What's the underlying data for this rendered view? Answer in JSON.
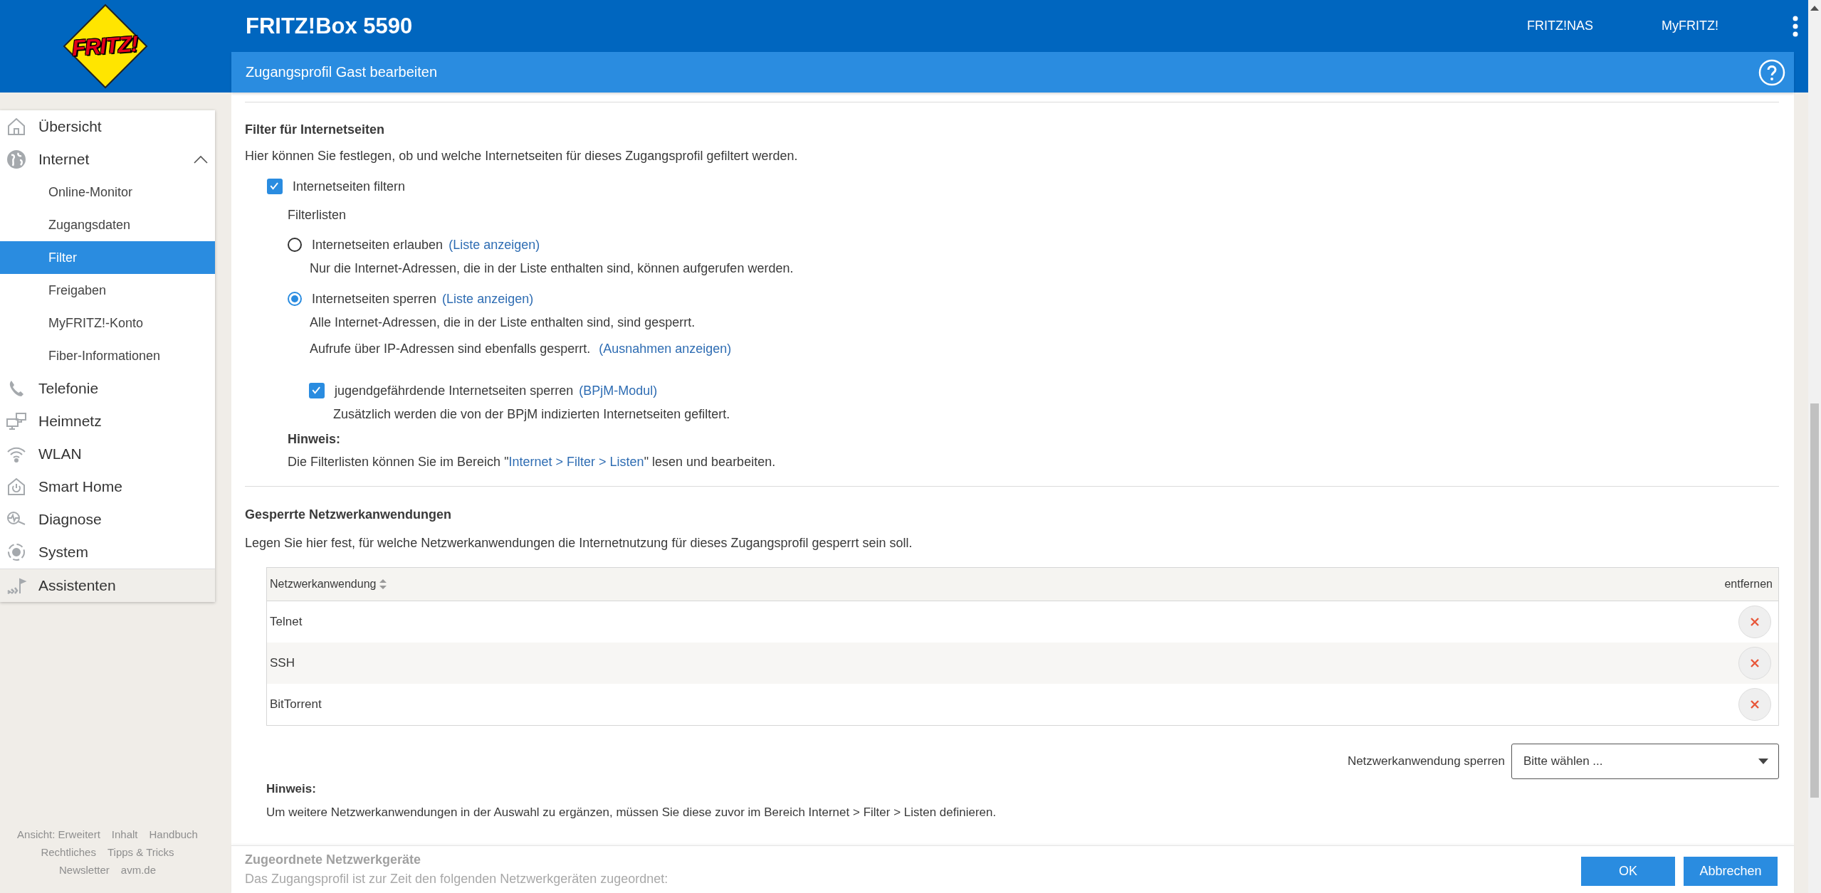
{
  "logo": {
    "text": "FRITZ!"
  },
  "header": {
    "title": "FRITZ!Box 5590",
    "links": [
      "FRITZ!NAS",
      "MyFRITZ!"
    ]
  },
  "sidebar": {
    "items": [
      {
        "label": "Übersicht",
        "kind": "home",
        "selected": false,
        "expanded": false
      },
      {
        "label": "Internet",
        "kind": "globe",
        "selected": false,
        "expanded": true,
        "children": [
          {
            "label": "Online-Monitor",
            "selected": false
          },
          {
            "label": "Zugangsdaten",
            "selected": false
          },
          {
            "label": "Filter",
            "selected": true
          },
          {
            "label": "Freigaben",
            "selected": false
          },
          {
            "label": "MyFRITZ!-Konto",
            "selected": false
          },
          {
            "label": "Fiber-Informationen",
            "selected": false
          }
        ]
      },
      {
        "label": "Telefonie",
        "kind": "phone",
        "selected": false,
        "expanded": false
      },
      {
        "label": "Heimnetz",
        "kind": "network",
        "selected": false,
        "expanded": false
      },
      {
        "label": "WLAN",
        "kind": "wifi",
        "selected": false,
        "expanded": false
      },
      {
        "label": "Smart Home",
        "kind": "smarthome",
        "selected": false,
        "expanded": false
      },
      {
        "label": "Diagnose",
        "kind": "diagnose",
        "selected": false,
        "expanded": false
      },
      {
        "label": "System",
        "kind": "system",
        "selected": false,
        "expanded": false
      },
      {
        "label": "Assistenten",
        "kind": "wizard",
        "selected": false,
        "expanded": false
      }
    ],
    "footer_links": [
      [
        "Ansicht: Erweitert",
        "Inhalt",
        "Handbuch"
      ],
      [
        "Rechtliches",
        "Tipps & Tricks"
      ],
      [
        "Newsletter",
        "avm.de"
      ]
    ]
  },
  "page": {
    "title": "Zugangsprofil Gast bearbeiten"
  },
  "web_filter": {
    "heading": "Filter für Internetseiten",
    "description": "Hier können Sie festlegen, ob und welche Internetseiten für dieses Zugangsprofil gefiltert werden.",
    "filter_checkbox": {
      "label": "Internetseiten filtern",
      "checked": true
    },
    "filterlists_label": "Filterlisten",
    "options": [
      {
        "label": "Internetseiten erlauben",
        "link": "(Liste anzeigen)",
        "selected": false,
        "descriptions": [
          {
            "text": "Nur die Internet-Adressen, die in der Liste enthalten sind, können aufgerufen werden."
          }
        ]
      },
      {
        "label": "Internetseiten sperren",
        "link": "(Liste anzeigen)",
        "selected": true,
        "descriptions": [
          {
            "text": "Alle Internet-Adressen, die in der Liste enthalten sind, sind gesperrt."
          },
          {
            "text": "Aufrufe über IP-Adressen sind ebenfalls gesperrt.",
            "link": "(Ausnahmen anzeigen)"
          }
        ]
      }
    ],
    "bpjm": {
      "label": "jugendgefährdende Internetseiten sperren",
      "link": "(BPjM-Modul)",
      "checked": true,
      "description": "Zusätzlich werden die von der BPjM indizierten Internetseiten gefiltert."
    },
    "note": {
      "heading": "Hinweis:",
      "before": "Die Filterlisten können Sie im Bereich \"",
      "link": "Internet > Filter > Listen",
      "after": "\" lesen und bearbeiten."
    }
  },
  "blocked_apps": {
    "heading": "Gesperrte Netzwerkanwendungen",
    "description": "Legen Sie hier fest, für welche Netzwerkanwendungen die Internetnutzung für dieses Zugangsprofil gesperrt sein soll.",
    "table": {
      "columns": [
        "Netzwerkanwendung",
        "entfernen"
      ],
      "rows": [
        {
          "name": "Telnet"
        },
        {
          "name": "SSH"
        },
        {
          "name": "BitTorrent"
        }
      ]
    },
    "add": {
      "label": "Netzwerkanwendung sperren",
      "value": "Bitte wählen ..."
    },
    "note": {
      "heading": "Hinweis:",
      "text": "Um weitere Netzwerkanwendungen in der Auswahl zu ergänzen, müssen Sie diese zuvor im Bereich Internet > Filter > Listen definieren."
    }
  },
  "assigned_devices": {
    "heading": "Zugeordnete Netzwerkgeräte",
    "description": "Das Zugangsprofil ist zur Zeit den folgenden Netzwerkgeräten zugeordnet:"
  },
  "buttons": [
    "OK",
    "Abbrechen"
  ]
}
